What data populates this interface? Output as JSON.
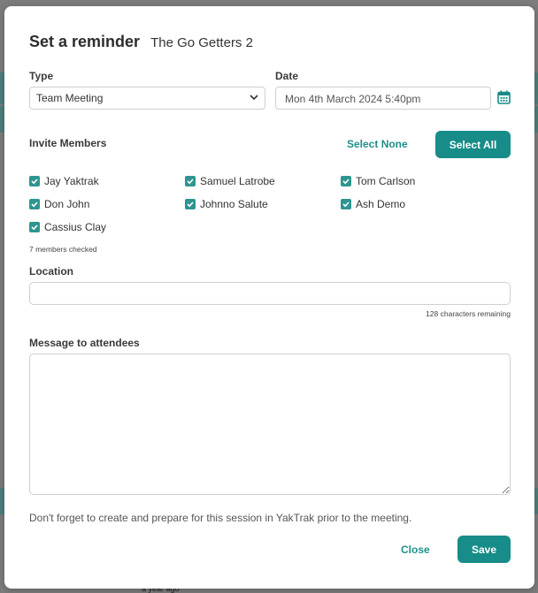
{
  "background": {
    "footer_text": "a year ago"
  },
  "modal": {
    "title": "Set a reminder",
    "group_name": "The Go Getters 2"
  },
  "type_field": {
    "label": "Type",
    "value": "Team Meeting"
  },
  "date_field": {
    "label": "Date",
    "value": "Mon 4th March 2024 5:40pm"
  },
  "invite": {
    "label": "Invite Members",
    "select_none_label": "Select None",
    "select_all_label": "Select All",
    "members": [
      {
        "name": "Jay Yaktrak",
        "checked": true
      },
      {
        "name": "Samuel Latrobe",
        "checked": true
      },
      {
        "name": "Tom Carlson",
        "checked": true
      },
      {
        "name": "Don John",
        "checked": true
      },
      {
        "name": "Johnno Salute",
        "checked": true
      },
      {
        "name": "Ash Demo",
        "checked": true
      },
      {
        "name": "Cassius Clay",
        "checked": true
      }
    ],
    "checked_count_text": "7 members checked"
  },
  "location": {
    "label": "Location",
    "value": "",
    "remaining_text": "128 characters remaining"
  },
  "message": {
    "label": "Message to attendees",
    "value": ""
  },
  "footer": {
    "note": "Don't forget to create and prepare for this session in YakTrak prior to the meeting.",
    "close_label": "Close",
    "save_label": "Save"
  },
  "colors": {
    "accent": "#178c88",
    "checkbox": "#2e9590"
  }
}
